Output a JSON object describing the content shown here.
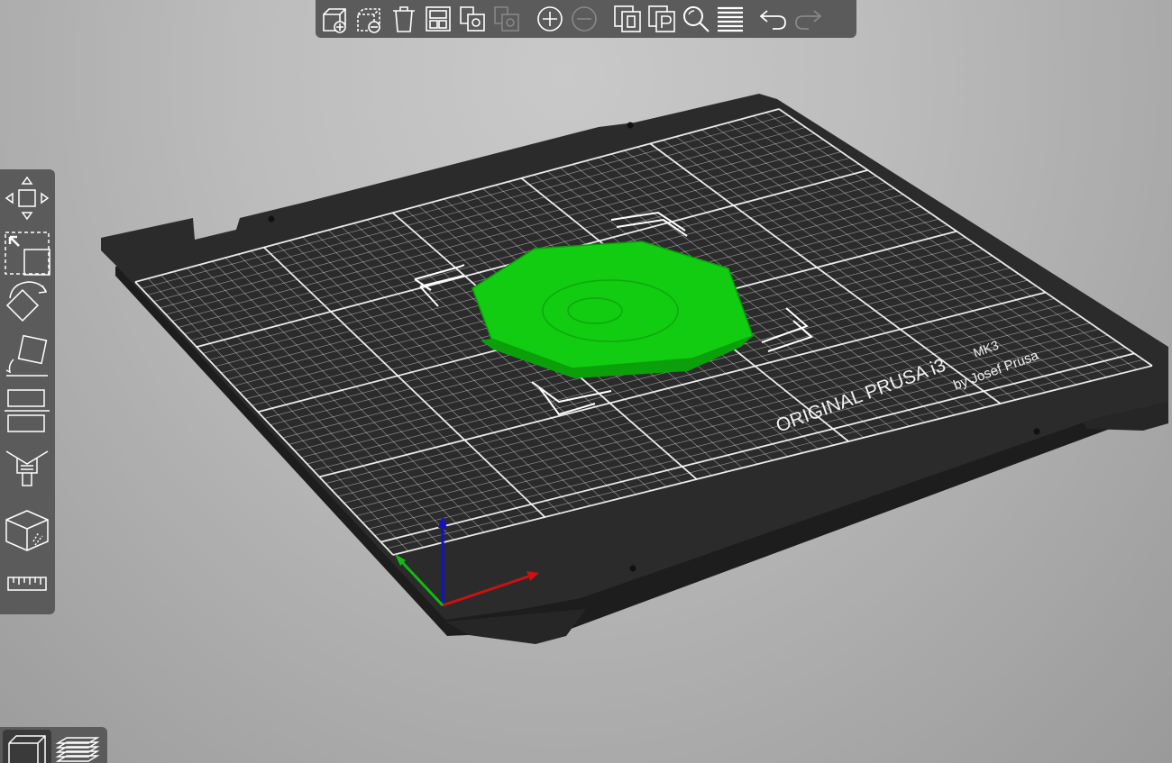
{
  "app": {
    "accent_color": "#00cc00",
    "toolbar_icon_color": "#ffffff"
  },
  "top_toolbar": {
    "buttons": [
      {
        "icon": "add-object-icon"
      },
      {
        "icon": "delete-object-icon"
      },
      {
        "icon": "delete-all-icon"
      },
      {
        "icon": "arrange-icon"
      },
      {
        "icon": "copy-icon"
      },
      {
        "icon": "paste-icon"
      },
      {
        "icon": "add-instance-icon"
      },
      {
        "icon": "remove-instance-icon"
      },
      {
        "icon": "split-to-objects-icon"
      },
      {
        "icon": "split-to-parts-icon"
      },
      {
        "icon": "search-icon"
      },
      {
        "icon": "layers-editing-icon"
      },
      {
        "icon": "undo-icon"
      },
      {
        "icon": "redo-icon"
      }
    ]
  },
  "left_toolbar": {
    "tools": [
      {
        "icon": "move-icon"
      },
      {
        "icon": "scale-icon"
      },
      {
        "icon": "rotate-icon"
      },
      {
        "icon": "place-on-face-icon"
      },
      {
        "icon": "cut-icon"
      },
      {
        "icon": "paint-supports-icon"
      },
      {
        "icon": "hollow-icon"
      },
      {
        "icon": "measure-icon"
      }
    ]
  },
  "view_switch": {
    "items": [
      {
        "icon": "3d-view-icon",
        "active": true
      },
      {
        "icon": "preview-layers-icon",
        "active": false
      }
    ]
  },
  "bed": {
    "brand_text": "ORIGINAL PRUSA i3",
    "model_text": "MK3",
    "byline_text": "by Josef Prusa",
    "plate_color": "#2b2b2b",
    "grid_color": "#ffffff"
  },
  "model": {
    "shape": "octagon",
    "color": "#11cc11"
  },
  "axes": {
    "x_color": "#cc1111",
    "y_color": "#11bb11",
    "z_color": "#1111cc"
  }
}
